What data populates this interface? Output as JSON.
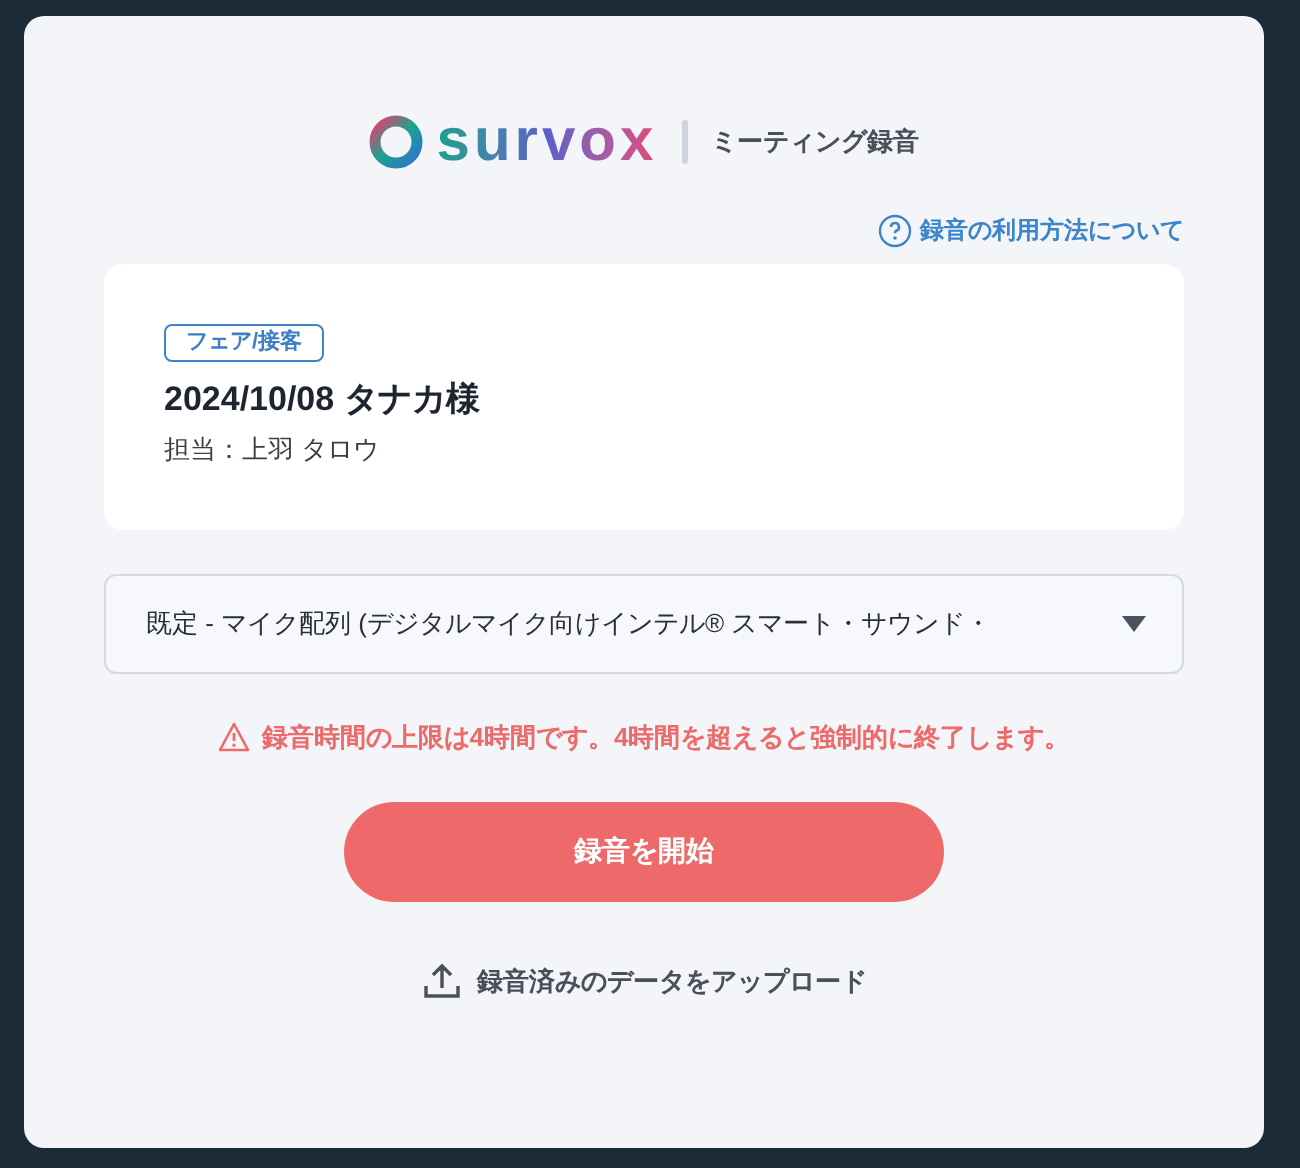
{
  "header": {
    "logo_text": "survox",
    "title": "ミーティング録音"
  },
  "help_link": {
    "label": "録音の利用方法について"
  },
  "meeting": {
    "tag": "フェア/接客",
    "title": "2024/10/08 タナカ様",
    "assignee": "担当：上羽 タロウ"
  },
  "microphone_select": {
    "value": "既定 - マイク配列 (デジタルマイク向けインテル® スマート・サウンド・"
  },
  "warning": "録音時間の上限は4時間です。4時間を超えると強制的に終了します。",
  "start_button": {
    "label": "録音を開始"
  },
  "upload_link": {
    "label": "録音済みのデータをアップロード"
  }
}
